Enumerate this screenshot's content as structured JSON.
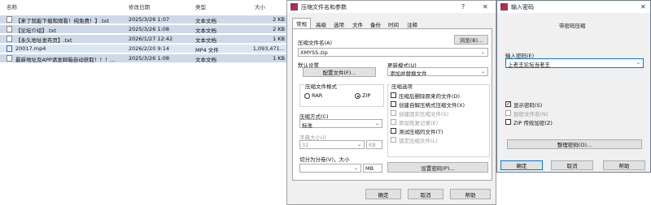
{
  "explorer": {
    "headers": {
      "name": "名称",
      "date": "修改日期",
      "type": "类型",
      "size": "大小"
    },
    "files": [
      {
        "name": "【来了就能下载和观看！纯免费！】.txt",
        "date": "2025/3/26 1:07",
        "type": "文本文档",
        "size": "2 KB"
      },
      {
        "name": "【论坛介绍】.txt",
        "date": "2025/3/26 1:08",
        "type": "文本文档",
        "size": "2 KB"
      },
      {
        "name": "【永久地址发布页】.txt",
        "date": "2026/1/27 12:42",
        "type": "文本文档",
        "size": "1 KB"
      },
      {
        "name": "20017.mp4",
        "date": "2026/2/20 9:14",
        "type": "MP4 文件",
        "size": "1,093,471..."
      },
      {
        "name": "最新地址及APP请发邮箱自动获取！！！...",
        "date": "2025/3/26 1:08",
        "type": "文本文档",
        "size": "1 KB"
      }
    ]
  },
  "archive_dialog": {
    "title": "压缩文件名和参数",
    "help_btn": "?",
    "close_btn": "✕",
    "tabs": [
      "常规",
      "高级",
      "选项",
      "文件",
      "备份",
      "时间",
      "注释"
    ],
    "filename_label": "压缩文件名(A)",
    "browse_label": "浏览(B)...",
    "filename_value": "XMYSS.zip",
    "default_settings_label": "默认设置",
    "profiles_btn": "配置文件(F)...",
    "update_mode_label": "更新模式(U)",
    "update_mode_value": "添加并替换文件",
    "format_label": "压缩文件格式",
    "format_rar": "RAR",
    "format_zip": "ZIP",
    "method_label": "压缩方式(C)",
    "method_value": "标准",
    "dict_label": "字典大小(I)",
    "dict_value": "32",
    "dict_unit": "KB",
    "split_label": "切分为分卷(V)，大小",
    "split_unit": "MB",
    "options_label": "压缩选项",
    "options": [
      {
        "label": "压缩后删除原来的文件(D)",
        "checked": false,
        "enabled": true
      },
      {
        "label": "创建自解压格式压缩文件(X)",
        "checked": false,
        "enabled": true
      },
      {
        "label": "创建固实压缩文件(S)",
        "checked": false,
        "enabled": false
      },
      {
        "label": "添加恢复记录(E)",
        "checked": false,
        "enabled": false
      },
      {
        "label": "测试压缩的文件(T)",
        "checked": false,
        "enabled": true
      },
      {
        "label": "锁定压缩文件(L)",
        "checked": false,
        "enabled": false
      }
    ],
    "set_password_btn": "设置密码(P)...",
    "ok_btn": "确定",
    "cancel_btn": "取消",
    "help_bottom_btn": "帮助"
  },
  "password_dialog": {
    "title": "输入密码",
    "close_btn": "✕",
    "header": "带密码压缩",
    "enter_password_label": "输入密码(E)",
    "password_value": "上老王论坛当老王",
    "show_password": {
      "label": "显示密码(S)",
      "checked": true,
      "enabled": true
    },
    "encrypt_names": {
      "label": "加密文件名(N)",
      "checked": false,
      "enabled": false
    },
    "zip_legacy": {
      "label": "ZIP 传统加密(Z)",
      "checked": false,
      "enabled": true
    },
    "organize_btn": "整理密码(O)...",
    "ok_btn": "确定",
    "cancel_btn": "取消",
    "help_btn": "帮助"
  },
  "colors": {
    "selection": "#cdd9e8",
    "dialog_bg": "#f0f0f0",
    "accent": "#0078d7"
  }
}
